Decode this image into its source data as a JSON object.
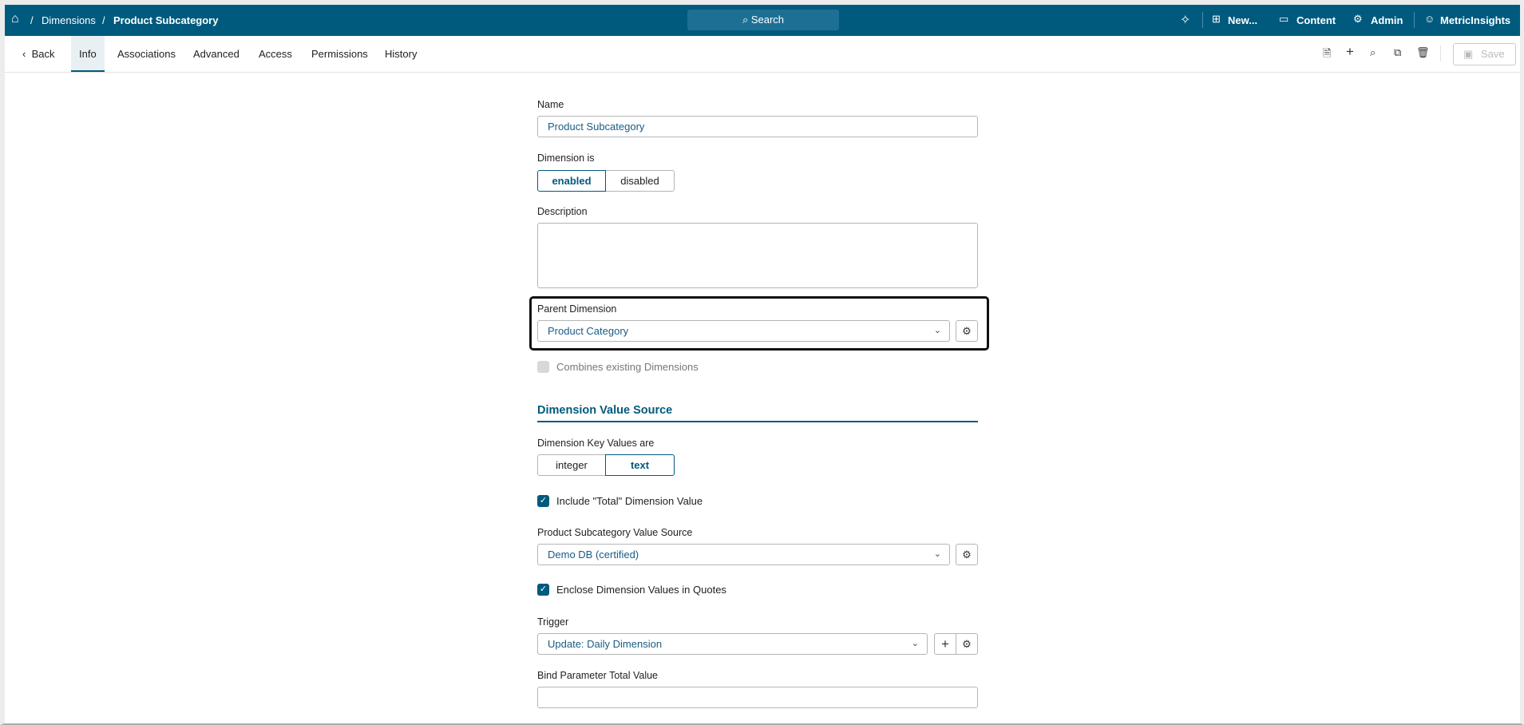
{
  "breadcrumb": {
    "items": [
      "Dimensions",
      "Product Subcategory"
    ]
  },
  "header": {
    "search": "Search",
    "new": "New...",
    "content": "Content",
    "admin": "Admin",
    "user": "MetricInsights"
  },
  "tabs": {
    "back": "Back",
    "items": [
      "Info",
      "Associations",
      "Advanced",
      "Access",
      "Permissions",
      "History"
    ],
    "active": "Info"
  },
  "toolbar": {
    "save": "Save"
  },
  "form": {
    "name_label": "Name",
    "name_value": "Product Subcategory",
    "status_label": "Dimension is",
    "status_options": [
      "enabled",
      "disabled"
    ],
    "status_selected": "enabled",
    "description_label": "Description",
    "description_value": "",
    "parent_label": "Parent Dimension",
    "parent_value": "Product Category",
    "combines_label": "Combines existing Dimensions",
    "section_title": "Dimension Value Source",
    "key_label": "Dimension Key Values are",
    "key_options": [
      "integer",
      "text"
    ],
    "key_selected": "text",
    "include_total_label": "Include \"Total\" Dimension Value",
    "source_label": "Product Subcategory Value Source",
    "source_value": "Demo DB (certified)",
    "enclose_label": "Enclose Dimension Values in Quotes",
    "trigger_label": "Trigger",
    "trigger_value": "Update: Daily Dimension",
    "bind_label": "Bind Parameter Total Value",
    "bind_value": ""
  },
  "colors": {
    "header": "#005a7d",
    "value_text": "#1a5c86"
  }
}
